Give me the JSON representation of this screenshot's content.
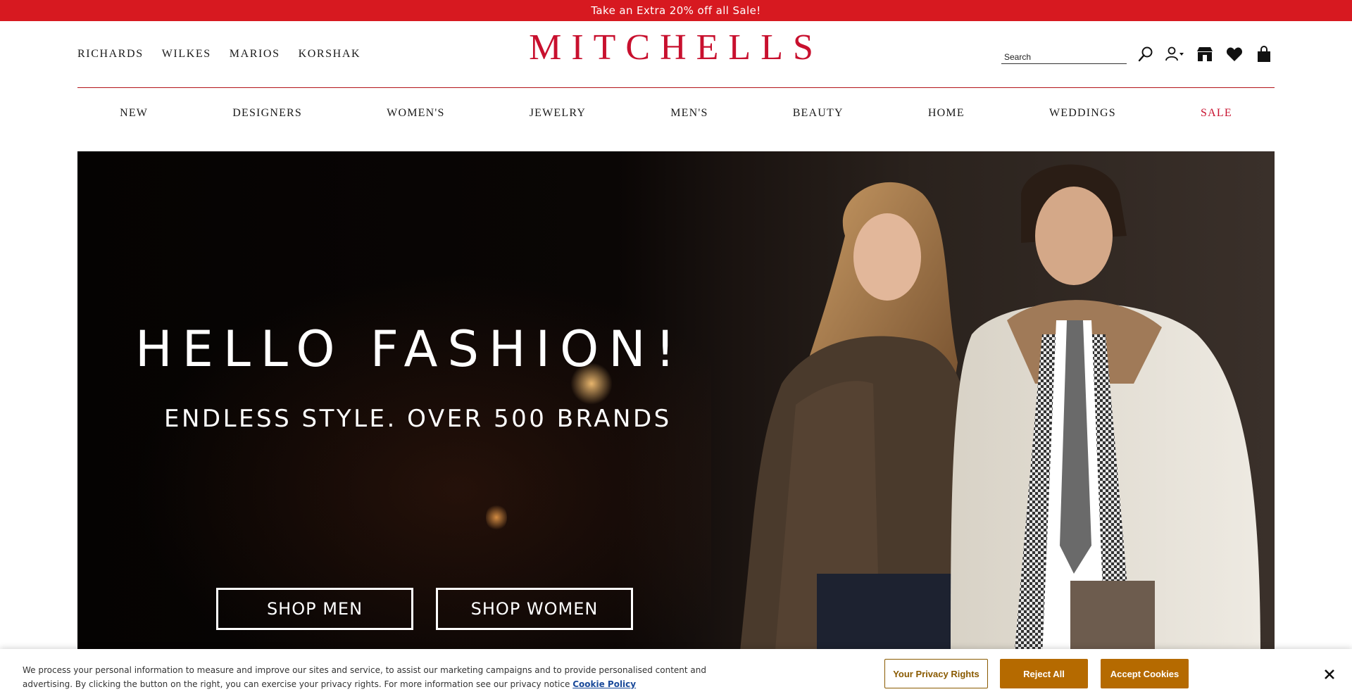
{
  "promo": {
    "text": "Take an Extra 20% off all Sale!"
  },
  "header": {
    "sister_stores": [
      "RICHARDS",
      "WILKES",
      "MARIOS",
      "KORSHAK"
    ],
    "logo": "MITCHELLS",
    "search": {
      "placeholder": "Search",
      "value": ""
    },
    "icons": [
      "search-icon",
      "account-icon",
      "store-icon",
      "heart-icon",
      "bag-icon"
    ]
  },
  "nav": {
    "items": [
      "NEW",
      "DESIGNERS",
      "WOMEN'S",
      "JEWELRY",
      "MEN'S",
      "BEAUTY",
      "HOME",
      "WEDDINGS",
      "SALE"
    ],
    "sale_color": "#c8102e"
  },
  "hero": {
    "title": "HELLO FASHION!",
    "subtitle": "ENDLESS STYLE. OVER 500 BRANDS",
    "buttons": {
      "men": "SHOP MEN",
      "women": "SHOP WOMEN"
    }
  },
  "cookie": {
    "text": "We process your personal information to measure and improve our sites and service, to assist our marketing campaigns and to provide personalised content and advertising. By clicking the button on the right, you can exercise your privacy rights. For more information see our privacy notice",
    "link": "Cookie Policy",
    "privacy_button": "Your Privacy Rights",
    "reject_button": "Reject All",
    "accept_button": "Accept Cookies",
    "accent": "#b56a00"
  },
  "colors": {
    "brand": "#c8102e",
    "promo_bg": "#d71920"
  }
}
